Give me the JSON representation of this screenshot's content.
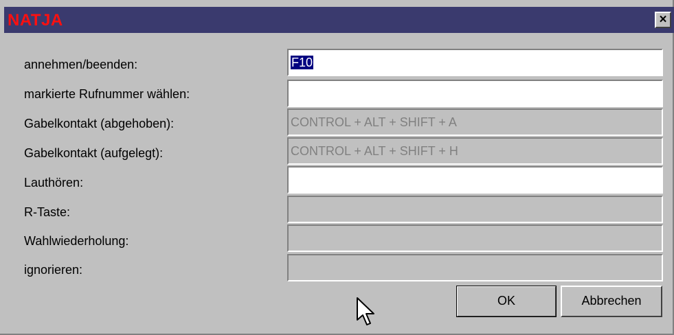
{
  "window": {
    "title": "NATJA",
    "close_label": "×"
  },
  "fields": [
    {
      "label": "annehmen/beenden:",
      "value": "F10"
    },
    {
      "label": "markierte Rufnummer wählen:",
      "value": ""
    },
    {
      "label": "Gabelkontakt (abgehoben):",
      "value": "CONTROL + ALT + SHIFT + A"
    },
    {
      "label": "Gabelkontakt (aufgelegt):",
      "value": "CONTROL + ALT + SHIFT + H"
    },
    {
      "label": "Lauthören:",
      "value": ""
    },
    {
      "label": "R-Taste:",
      "value": ""
    },
    {
      "label": "Wahlwiederholung:",
      "value": ""
    },
    {
      "label": "ignorieren:",
      "value": ""
    }
  ],
  "buttons": {
    "ok_label": "OK",
    "cancel_label": "Abbrechen"
  }
}
